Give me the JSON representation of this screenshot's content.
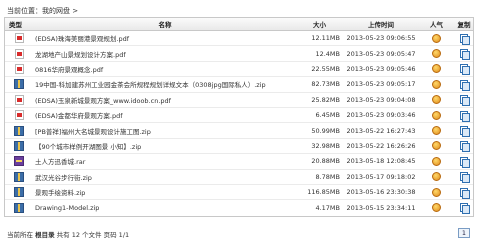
{
  "breadcrumb": {
    "prefix": "当前位置：",
    "link": "我的网盘",
    "suffix": " >"
  },
  "columns": {
    "type": "类型",
    "name": "名称",
    "size": "大小",
    "time": "上传时间",
    "popularity": "人气",
    "copy": "复制"
  },
  "files": [
    {
      "icon": "pdf-icon",
      "name": "(EDSA)珠海美丽港景观规划.pdf",
      "size": "12.11MB",
      "time": "2013-05-23 09:06:55"
    },
    {
      "icon": "pdf-icon",
      "name": "龙湖地产山景规划设计方案.pdf",
      "size": "12.4MB",
      "time": "2013-05-23 09:05:47"
    },
    {
      "icon": "pdf-icon",
      "name": "0816华府景观概念.pdf",
      "size": "22.55MB",
      "time": "2013-05-23 09:05:46"
    },
    {
      "icon": "zip-icon",
      "name": "19中国-科加建苏州工业园金茶会所规程规划详规文本（0308jpg国际私人）.zip",
      "size": "82.73MB",
      "time": "2013-05-23 09:05:17"
    },
    {
      "icon": "pdf-icon",
      "name": "(EDSA)玉泉新城景观方案_www.idoob.cn.pdf",
      "size": "25.82MB",
      "time": "2013-05-23 09:04:08"
    },
    {
      "icon": "pdf-icon",
      "name": "(EDSA)金都华府景观方案.pdf",
      "size": "6.45MB",
      "time": "2013-05-23 09:03:46"
    },
    {
      "icon": "zip-icon",
      "name": "[PB普祥]福州大名城景观设计施工图.zip",
      "size": "50.99MB",
      "time": "2013-05-22 16:27:43"
    },
    {
      "icon": "zip-icon",
      "name": "【90个城市样例开湖图景 小知】.zip",
      "size": "32.98MB",
      "time": "2013-05-22 16:26:26"
    },
    {
      "icon": "rar-icon",
      "name": "土人方迅香城.rar",
      "size": "20.88MB",
      "time": "2013-05-18 12:08:45"
    },
    {
      "icon": "zip-icon",
      "name": "武汉光谷步行街.zip",
      "size": "8.78MB",
      "time": "2013-05-17 09:18:02"
    },
    {
      "icon": "zip-icon",
      "name": "景观手绘资料.zip",
      "size": "116.85MB",
      "time": "2013-05-16 23:30:38"
    },
    {
      "icon": "zip-icon",
      "name": "Drawing1-Model.zip",
      "size": "4.17MB",
      "time": "2013-05-15 23:34:11"
    }
  ],
  "footer": {
    "prefix": "当前所在 ",
    "dir": "根目录",
    "summary": " 共有 12 个文件 页码 1/1"
  },
  "pager": {
    "current": "1"
  }
}
